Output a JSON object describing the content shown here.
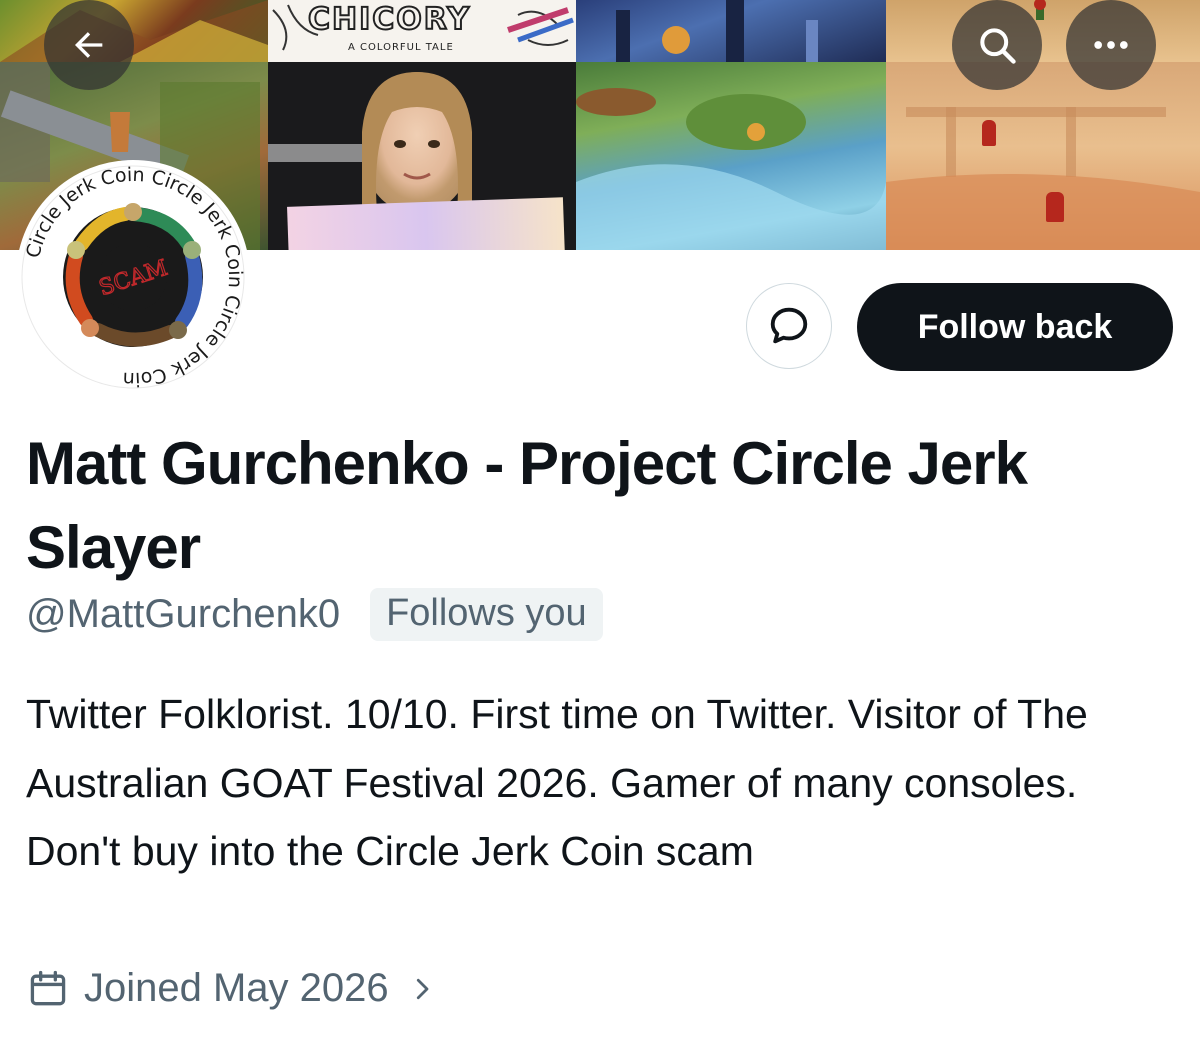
{
  "header": {
    "back_icon": "arrow-left-icon",
    "search_icon": "search-icon",
    "more_icon": "more-horizontal-icon"
  },
  "banner": {
    "chicory_title": "CHICORY",
    "chicory_subtitle": "A COLORFUL TALE"
  },
  "avatar": {
    "ring_text": "Circle Jerk Coin",
    "center_text": "SCAM"
  },
  "actions": {
    "message_icon": "message-bubble-icon",
    "follow_label": "Follow back"
  },
  "profile": {
    "name": "Matt Gurchenko - Project Circle Jerk Slayer",
    "handle": "@MattGurchenk0",
    "follows_you": "Follows you",
    "bio": "Twitter Folklorist. 10/10. First time on Twitter. Visitor of The Australian GOAT Festival 2026. Gamer of many consoles. Don't buy into the Circle Jerk Coin scam",
    "joined": "Joined May 2026"
  },
  "colors": {
    "text_primary": "#0f1419",
    "text_secondary": "#536471",
    "button_dark": "#0f1419",
    "badge_bg": "#eff3f4"
  }
}
